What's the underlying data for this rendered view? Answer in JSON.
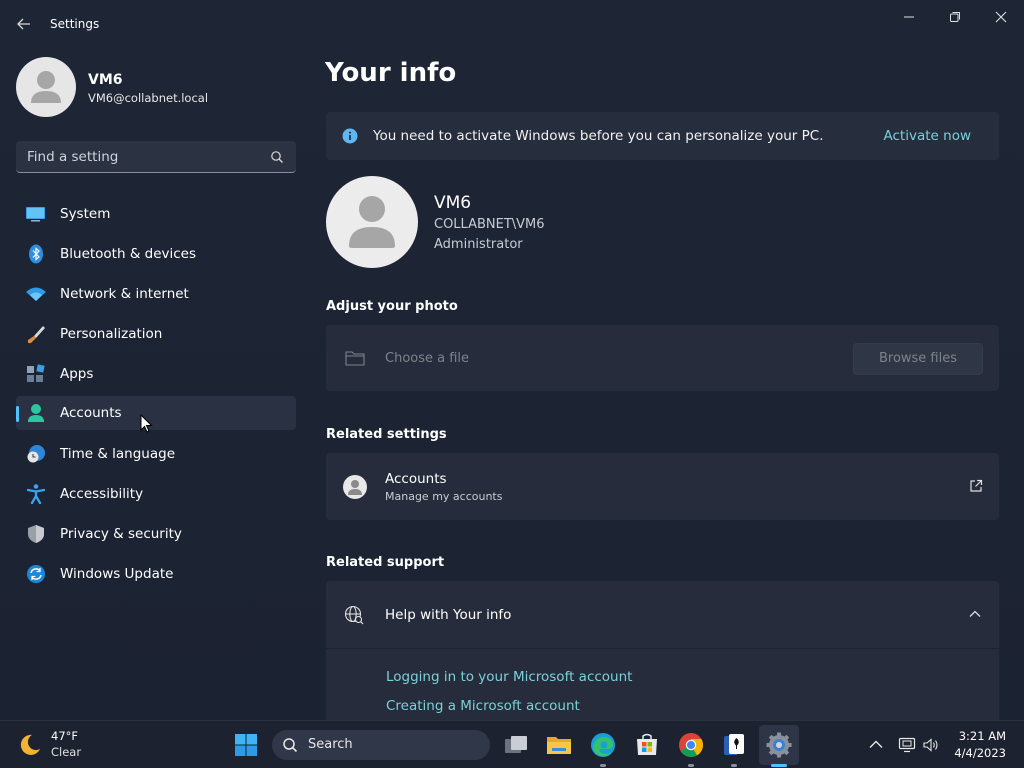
{
  "window": {
    "title": "Settings"
  },
  "profile": {
    "name": "VM6",
    "email": "VM6@collabnet.local"
  },
  "search": {
    "placeholder": "Find a setting"
  },
  "sidebar": {
    "items": [
      {
        "label": "System",
        "icon": "system-icon"
      },
      {
        "label": "Bluetooth & devices",
        "icon": "bluetooth-icon"
      },
      {
        "label": "Network & internet",
        "icon": "wifi-icon"
      },
      {
        "label": "Personalization",
        "icon": "brush-icon"
      },
      {
        "label": "Apps",
        "icon": "apps-icon"
      },
      {
        "label": "Accounts",
        "icon": "accounts-icon",
        "selected": true
      },
      {
        "label": "Time & language",
        "icon": "clock-globe-icon"
      },
      {
        "label": "Accessibility",
        "icon": "accessibility-icon"
      },
      {
        "label": "Privacy & security",
        "icon": "shield-icon"
      },
      {
        "label": "Windows Update",
        "icon": "update-icon"
      }
    ]
  },
  "main": {
    "title": "Your info",
    "banner": {
      "message": "You need to activate Windows before you can personalize your PC.",
      "link": "Activate now"
    },
    "user": {
      "name": "VM6",
      "domain": "COLLABNET\\VM6",
      "role": "Administrator"
    },
    "adjust_photo": {
      "heading": "Adjust your photo",
      "placeholder": "Choose a file",
      "button": "Browse files"
    },
    "related_settings": {
      "heading": "Related settings",
      "accounts_title": "Accounts",
      "accounts_subtitle": "Manage my accounts"
    },
    "related_support": {
      "heading": "Related support",
      "help_title": "Help with Your info",
      "links": [
        "Logging in to your Microsoft account",
        "Creating a Microsoft account"
      ]
    }
  },
  "taskbar": {
    "weather_temp": "47°F",
    "weather_condition": "Clear",
    "search_label": "Search",
    "time": "3:21 AM",
    "date": "4/4/2023"
  },
  "colors": {
    "accent": "#4cc2ff",
    "link": "#7ad1d9",
    "background": "#1c2330"
  }
}
